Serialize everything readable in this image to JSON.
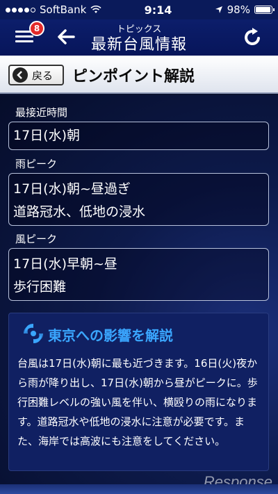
{
  "status_bar": {
    "carrier": "SoftBank",
    "time": "9:14",
    "battery": "98%",
    "signal_bars": 4
  },
  "nav": {
    "subtitle": "トピックス",
    "title": "最新台風情報",
    "badge_count": "8"
  },
  "header": {
    "return_label": "戻る",
    "title": "ピンポイント解説"
  },
  "fields": {
    "closest": {
      "label": "最接近時間",
      "value": "17日(水)朝"
    },
    "rain_peak": {
      "label": "雨ピーク",
      "time": "17日(水)朝~昼過ぎ",
      "impact": "道路冠水、低地の浸水"
    },
    "wind_peak": {
      "label": "風ピーク",
      "time": "17日(水)早朝~昼",
      "impact": "歩行困難"
    }
  },
  "impact": {
    "title": "東京への影響を解説",
    "body": "台風は17日(水)朝に最も近づきます。16日(火)夜から雨が降り出し、17日(水)朝から昼がピークに。歩行困難レベルの強い風を伴い、横殴りの雨になります。道路冠水や低地の浸水に注意が必要です。また、海岸では高波にも注意をしてください。"
  },
  "watermark": "Response",
  "colors": {
    "accent": "#3aa6ff",
    "badge": "#e22a2a",
    "nav_bg": "#0c1e6b"
  }
}
